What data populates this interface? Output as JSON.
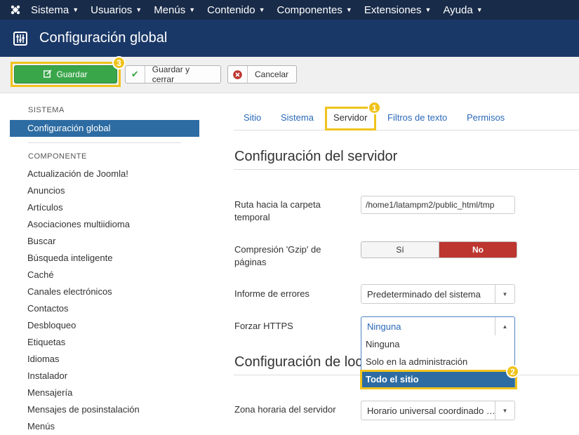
{
  "topnav": {
    "logo_icon": "joomla-logo-icon",
    "items": [
      {
        "label": "Sistema"
      },
      {
        "label": "Usuarios"
      },
      {
        "label": "Menús"
      },
      {
        "label": "Contenido"
      },
      {
        "label": "Componentes"
      },
      {
        "label": "Extensiones"
      },
      {
        "label": "Ayuda"
      }
    ]
  },
  "header": {
    "icon": "sliders-icon",
    "title": "Configuración global"
  },
  "toolbar": {
    "save_label": "Guardar",
    "save_close_label": "Guardar y cerrar",
    "cancel_label": "Cancelar"
  },
  "annotations": {
    "badge_1": "1",
    "badge_2": "2",
    "badge_3": "3",
    "highlight_color": "#f0c31c"
  },
  "sidebar": {
    "heading_sistema": "SISTEMA",
    "active_item": "Configuración global",
    "heading_componente": "COMPONENTE",
    "items": [
      {
        "label": "Actualización de Joomla!"
      },
      {
        "label": "Anuncios"
      },
      {
        "label": "Artículos"
      },
      {
        "label": "Asociaciones multiidioma"
      },
      {
        "label": "Buscar"
      },
      {
        "label": "Búsqueda inteligente"
      },
      {
        "label": "Caché"
      },
      {
        "label": "Canales electrónicos"
      },
      {
        "label": "Contactos"
      },
      {
        "label": "Desbloqueo"
      },
      {
        "label": "Etiquetas"
      },
      {
        "label": "Idiomas"
      },
      {
        "label": "Instalador"
      },
      {
        "label": "Mensajería"
      },
      {
        "label": "Mensajes de posinstalación"
      },
      {
        "label": "Menús"
      }
    ]
  },
  "tabs": [
    {
      "label": "Sitio"
    },
    {
      "label": "Sistema"
    },
    {
      "label": "Servidor",
      "active": true
    },
    {
      "label": "Filtros de texto"
    },
    {
      "label": "Permisos"
    }
  ],
  "main": {
    "section_title": "Configuración del servidor",
    "section2_title": "Configuración de locali",
    "tmp_path_label": "Ruta hacia la carpeta temporal",
    "tmp_path_value": "/home1/latampm2/public_html/tmp",
    "gzip_label": "Compresión 'Gzip' de páginas",
    "gzip_yes": "Sí",
    "gzip_no": "No",
    "gzip_value": "No",
    "errors_label": "Informe de errores",
    "errors_value": "Predeterminado del sistema",
    "https_label": "Forzar HTTPS",
    "https_value": "Ninguna",
    "https_options": [
      {
        "label": "Ninguna"
      },
      {
        "label": "Solo en la administración"
      },
      {
        "label": "Todo el sitio",
        "highlighted": true
      }
    ],
    "timezone_label": "Zona horaria del servidor",
    "timezone_value": "Horario universal coordinado …"
  }
}
